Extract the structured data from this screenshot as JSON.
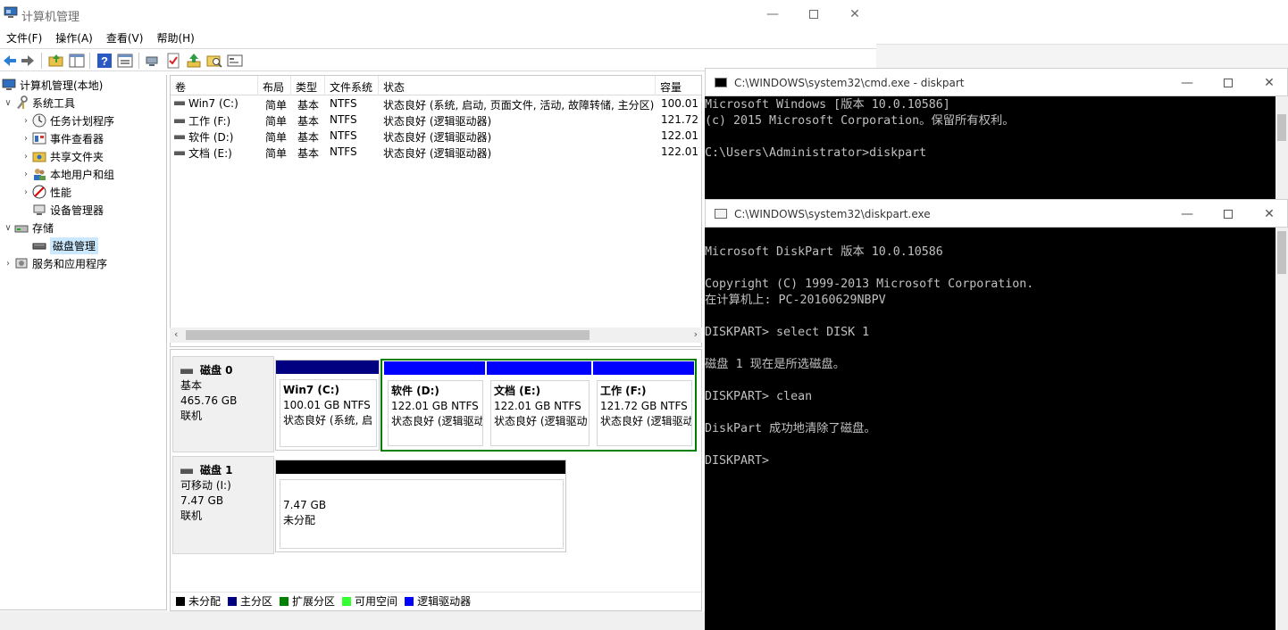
{
  "cm": {
    "title": "计算机管理",
    "menus": [
      "文件(F)",
      "操作(A)",
      "查看(V)",
      "帮助(H)"
    ]
  },
  "tree": {
    "root": "计算机管理(本地)",
    "items": [
      {
        "label": "系统工具"
      },
      {
        "label": "任务计划程序"
      },
      {
        "label": "事件查看器"
      },
      {
        "label": "共享文件夹"
      },
      {
        "label": "本地用户和组"
      },
      {
        "label": "性能"
      },
      {
        "label": "设备管理器"
      },
      {
        "label": "存储"
      },
      {
        "label": "磁盘管理"
      },
      {
        "label": "服务和应用程序"
      }
    ]
  },
  "volumes": {
    "columns": [
      "卷",
      "布局",
      "类型",
      "文件系统",
      "状态",
      "容量"
    ],
    "rows": [
      [
        "Win7 (C:)",
        "简单",
        "基本",
        "NTFS",
        "状态良好 (系统, 启动, 页面文件, 活动, 故障转储, 主分区)",
        "100.01 G"
      ],
      [
        "工作 (F:)",
        "简单",
        "基本",
        "NTFS",
        "状态良好 (逻辑驱动器)",
        "121.72 G"
      ],
      [
        "软件 (D:)",
        "简单",
        "基本",
        "NTFS",
        "状态良好 (逻辑驱动器)",
        "122.01 G"
      ],
      [
        "文档 (E:)",
        "简单",
        "基本",
        "NTFS",
        "状态良好 (逻辑驱动器)",
        "122.01 G"
      ]
    ]
  },
  "disks": [
    {
      "name": "磁盘 0",
      "type": "基本",
      "size": "465.76 GB",
      "status": "联机",
      "partitions": [
        {
          "name": "Win7  (C:)",
          "size": "100.01 GB NTFS",
          "status": "状态良好 (系统, 启"
        },
        {
          "name": "软件  (D:)",
          "size": "122.01 GB NTFS",
          "status": "状态良好 (逻辑驱动"
        },
        {
          "name": "文档  (E:)",
          "size": "122.01 GB NTFS",
          "status": "状态良好 (逻辑驱动"
        },
        {
          "name": "工作  (F:)",
          "size": "121.72 GB NTFS",
          "status": "状态良好 (逻辑驱动"
        }
      ]
    },
    {
      "name": "磁盘 1",
      "type": "可移动 (I:)",
      "size": "7.47 GB",
      "status": "联机",
      "partitions": [
        {
          "name": "",
          "size": "7.47 GB",
          "status": "未分配"
        }
      ]
    }
  ],
  "legend": [
    {
      "label": "未分配",
      "color": "#000000"
    },
    {
      "label": "主分区",
      "color": "#000080"
    },
    {
      "label": "扩展分区",
      "color": "#008000"
    },
    {
      "label": "可用空间",
      "color": "#33ff33"
    },
    {
      "label": "逻辑驱动器",
      "color": "#0000ff"
    }
  ],
  "cmd": {
    "title": "C:\\WINDOWS\\system32\\cmd.exe - diskpart",
    "lines": "Microsoft Windows [版本 10.0.10586]\n(c) 2015 Microsoft Corporation。保留所有权利。\n\nC:\\Users\\Administrator>diskpart"
  },
  "diskpart": {
    "title": "C:\\WINDOWS\\system32\\diskpart.exe",
    "lines": "\nMicrosoft DiskPart 版本 10.0.10586\n\nCopyright (C) 1999-2013 Microsoft Corporation.\n在计算机上: PC-20160629NBPV\n\nDISKPART> select DISK 1\n\n磁盘 1 现在是所选磁盘。\n\nDISKPART> clean\n\nDiskPart 成功地清除了磁盘。\n\nDISKPART> "
  }
}
